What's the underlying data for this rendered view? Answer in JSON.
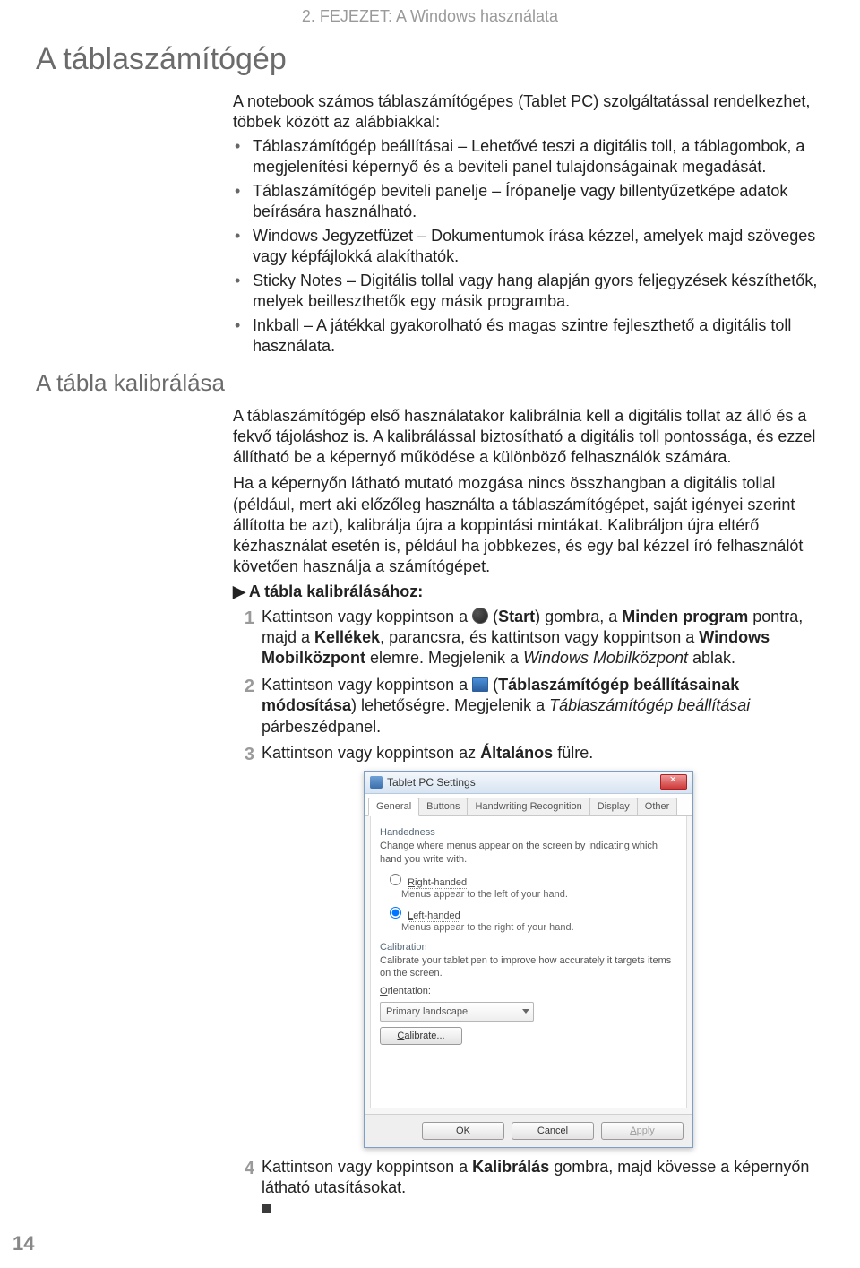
{
  "chapter_header": "2. FEJEZET: A Windows használata",
  "main_title": "A táblaszámítógép",
  "intro": "A notebook számos táblaszámítógépes (Tablet PC) szolgáltatással rendelkezhet, többek között az alábbiakkal:",
  "bullets": [
    "Táblaszámítógép beállításai – Lehetővé teszi a digitális toll, a táblagombok, a megjelenítési képernyő és a beviteli panel tulajdonságainak megadását.",
    "Táblaszámítógép beviteli panelje – Írópanelje vagy billentyűzetképe adatok beírására használható.",
    "Windows Jegyzetfüzet – Dokumentumok írása kézzel, amelyek majd szöveges vagy képfájlokká alakíthatók.",
    "Sticky Notes – Digitális tollal vagy hang alapján gyors feljegyzések készíthetők, melyek beilleszthetők egy másik programba.",
    "Inkball – A játékkal gyakorolható és magas szintre fejleszthető a digitális toll használata."
  ],
  "section2_title": "A tábla kalibrálása",
  "para1": "A táblaszámítógép első használatakor kalibrálnia kell a digitális tollat az álló és a fekvő tájoláshoz is. A kalibrálással biztosítható a digitális toll pontossága, és ezzel állítható be a képernyő működése a különböző felhasználók számára.",
  "para2": "Ha a képernyőn látható mutató mozgása nincs összhangban a digitális tollal (például, mert aki előzőleg használta a táblaszámítógépet, saját igényei szerint állította be azt), kalibrálja újra a koppintási mintákat. Kalibráljon újra eltérő kézhasználat esetén is, például ha jobbkezes, és egy bal kézzel író felhasználót követően használja a számítógépet.",
  "proc_heading": "A tábla kalibrálásához:",
  "steps": {
    "s1_pre": "Kattintson vagy koppintson a ",
    "s1_post_a": " (",
    "s1_start": "Start",
    "s1_post_b": ") gombra, a ",
    "s1_minden": "Minden program",
    "s1_post_c": " pontra, majd a ",
    "s1_kellek": "Kellékek",
    "s1_post_d": ", parancsra, és kattintson vagy koppintson a ",
    "s1_mobil": "Windows Mobilközpont",
    "s1_post_e": " elemre. Megjelenik a ",
    "s1_italic": "Windows Mobilközpont",
    "s1_post_f": " ablak.",
    "s2_pre": "Kattintson vagy koppintson a ",
    "s2_post_a": " (",
    "s2_bold": "Táblaszámítógép beállításainak módosítása",
    "s2_post_b": ") lehetőségre. Megjelenik a ",
    "s2_italic": "Táblaszámítógép beállításai",
    "s2_post_c": " párbeszédpanel.",
    "s3_pre": "Kattintson vagy koppintson az ",
    "s3_bold": "Általános",
    "s3_post": " fülre.",
    "s4_pre": "Kattintson vagy koppintson a ",
    "s4_bold": "Kalibrálás",
    "s4_post": " gombra, majd kövesse a képernyőn látható utasításokat."
  },
  "dialog": {
    "title": "Tablet PC Settings",
    "tabs": [
      "General",
      "Buttons",
      "Handwriting Recognition",
      "Display",
      "Other"
    ],
    "handedness_label": "Handedness",
    "handedness_desc": "Change where menus appear on the screen by indicating which hand you write with.",
    "right_label": "Right-handed",
    "right_sub": "Menus appear to the left of your hand.",
    "left_label": "Left-handed",
    "left_sub": "Menus appear to the right of your hand.",
    "calibration_label": "Calibration",
    "calibration_desc": "Calibrate your tablet pen to improve how accurately it targets items on the screen.",
    "orientation_label": "Orientation:",
    "orientation_value": "Primary landscape",
    "calibrate_btn": "Calibrate...",
    "ok": "OK",
    "cancel": "Cancel",
    "apply": "Apply"
  },
  "page_number": "14"
}
